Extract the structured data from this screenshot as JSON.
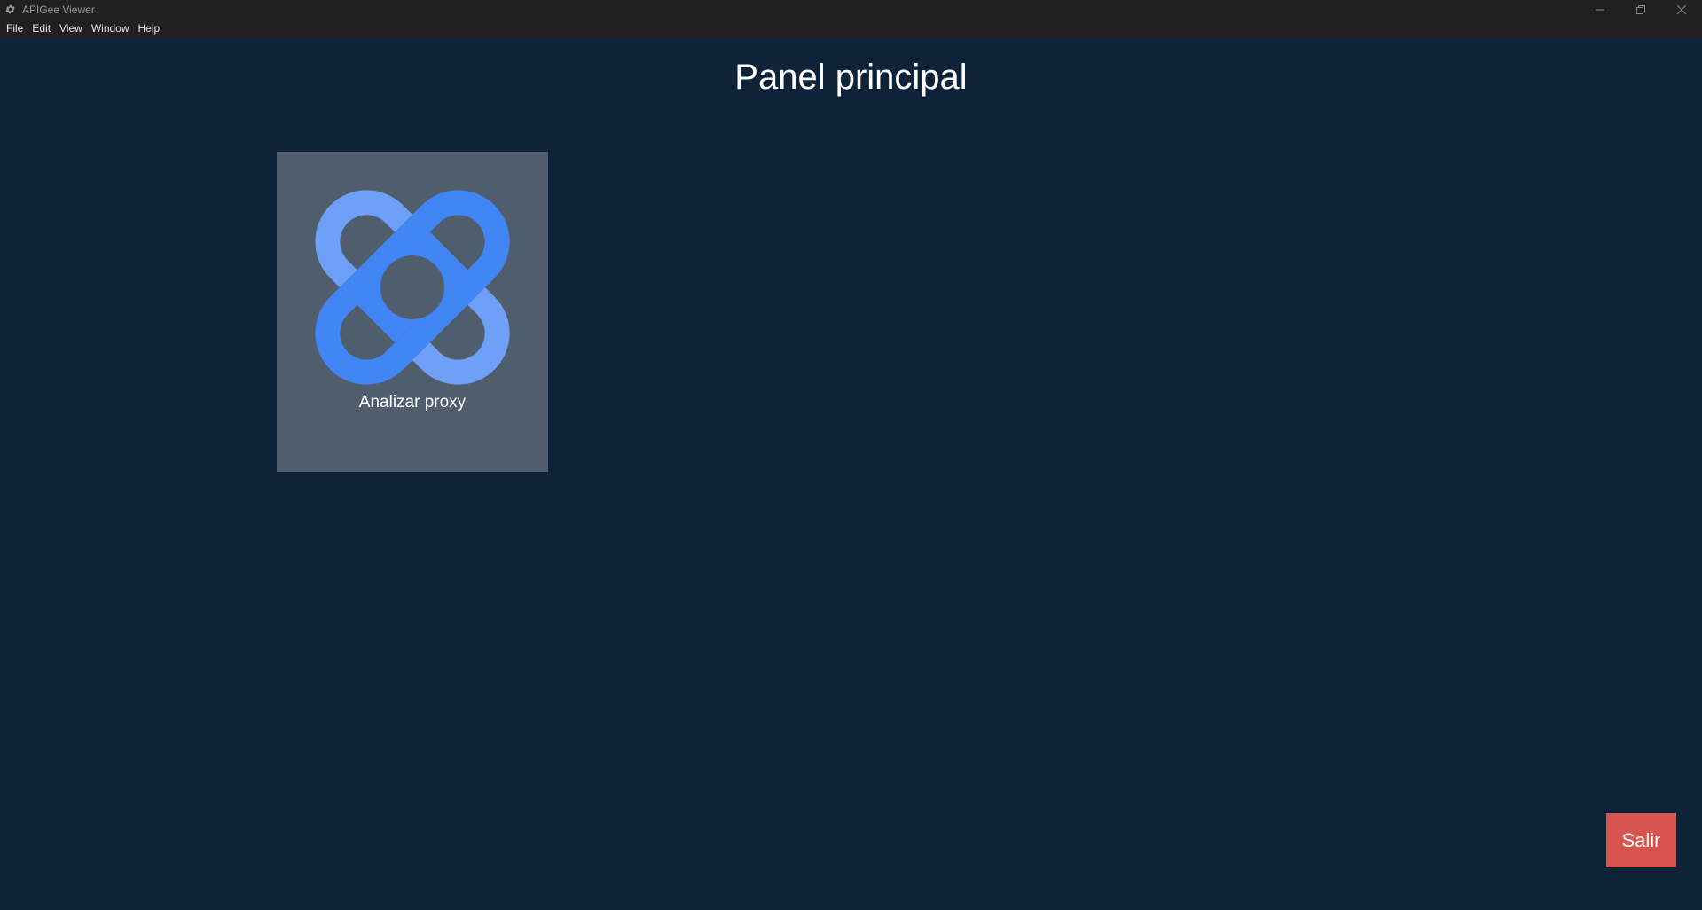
{
  "window": {
    "title": "APIGee Viewer",
    "icon": "gear-icon",
    "controls": {
      "minimize": "minimize-icon",
      "restore": "restore-icon",
      "close": "close-icon"
    }
  },
  "menubar": {
    "items": [
      {
        "label": "File"
      },
      {
        "label": "Edit"
      },
      {
        "label": "View"
      },
      {
        "label": "Window"
      },
      {
        "label": "Help"
      }
    ]
  },
  "main": {
    "title": "Panel principal",
    "cards": [
      {
        "label": "Analizar proxy",
        "icon": "bandage-icon"
      }
    ],
    "exit_button": "Salir"
  },
  "colors": {
    "background": "#0f2338",
    "titlebar": "#202020",
    "card": "#4f5d6d",
    "accent_blue": "#4285f4",
    "accent_blue_light": "#6ea0f7",
    "exit": "#d9534f"
  }
}
